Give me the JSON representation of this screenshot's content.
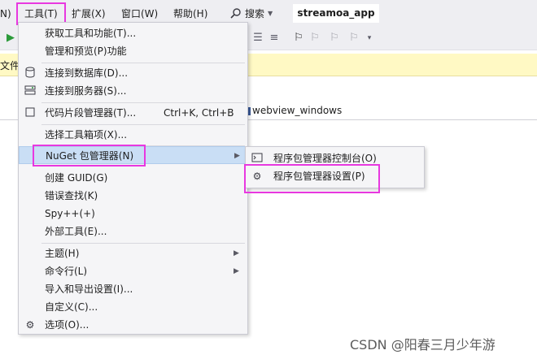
{
  "menubar": {
    "partial_left": "N)",
    "tools": "工具(T)",
    "extensions": "扩展(X)",
    "window": "窗口(W)",
    "help": "帮助(H)",
    "search": "搜索",
    "app_title": "streamoa_app"
  },
  "infobar": {
    "text": "文件"
  },
  "tab": {
    "label": "webview_windows"
  },
  "tools_menu": {
    "items": [
      {
        "label": "获取工具和功能(T)..."
      },
      {
        "label": "管理和预览(P)功能"
      },
      {
        "label": "连接到数据库(D)..."
      },
      {
        "label": "连接到服务器(S)..."
      },
      {
        "label": "代码片段管理器(T)...",
        "shortcut": "Ctrl+K, Ctrl+B"
      },
      {
        "label": "选择工具箱项(X)..."
      },
      {
        "label": "NuGet 包管理器(N)"
      },
      {
        "label": "创建 GUID(G)"
      },
      {
        "label": "错误查找(K)"
      },
      {
        "label": "Spy++(+)"
      },
      {
        "label": "外部工具(E)..."
      },
      {
        "label": "主题(H)"
      },
      {
        "label": "命令行(L)"
      },
      {
        "label": "导入和导出设置(I)..."
      },
      {
        "label": "自定义(C)..."
      },
      {
        "label": "选项(O)..."
      }
    ]
  },
  "nuget_submenu": {
    "items": [
      {
        "label": "程序包管理器控制台(O)"
      },
      {
        "label": "程序包管理器设置(P)"
      }
    ]
  },
  "watermark": "CSDN @阳春三月少年游",
  "colors": {
    "highlight_box": "#e838e0",
    "selected_item": "#c9def5",
    "infobar": "#fff9c4",
    "chrome": "#eeeef2"
  },
  "icons": [
    "search-icon",
    "play-icon",
    "database-icon",
    "server-icon",
    "snippet-icon",
    "console-icon",
    "gear-icon",
    "bookmark-icon"
  ]
}
